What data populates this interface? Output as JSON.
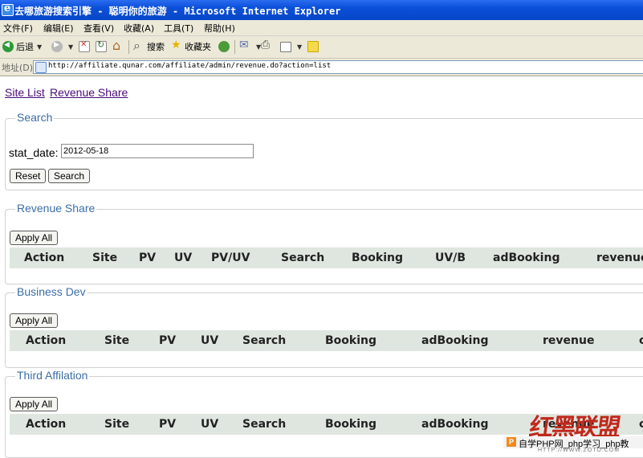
{
  "window": {
    "title": "去哪旅游搜索引擎 - 聪明你的旅游 - Microsoft Internet Explorer"
  },
  "menu": [
    "文件(F)",
    "编辑(E)",
    "查看(V)",
    "收藏(A)",
    "工具(T)",
    "帮助(H)"
  ],
  "toolbar": {
    "back": "后退",
    "search": "搜索",
    "favorites": "收藏夹"
  },
  "address": {
    "label": "地址(D)",
    "url": "http://affiliate.qunar.com/affiliate/admin/revenue.do?action=list"
  },
  "nav": {
    "site_list": "Site List",
    "revenue_share": "Revenue Share"
  },
  "search": {
    "legend": "Search",
    "field_label": "stat_date:",
    "field_value": "2012-05-18",
    "reset": "Reset",
    "search": "Search"
  },
  "sections": [
    {
      "legend": "Revenue Share",
      "apply": "Apply All",
      "columns": [
        "Action",
        "Site",
        "PV",
        "UV",
        "PV/UV",
        "Search",
        "Booking",
        "UV/B",
        "adBooking",
        "revenue"
      ]
    },
    {
      "legend": "Business Dev",
      "apply": "Apply All",
      "columns": [
        "Action",
        "Site",
        "PV",
        "UV",
        "Search",
        "Booking",
        "adBooking",
        "revenue",
        "c"
      ]
    },
    {
      "legend": "Third Affilation",
      "apply": "Apply All",
      "columns": [
        "Action",
        "Site",
        "PV",
        "UV",
        "Search",
        "Booking",
        "adBooking",
        "revenue",
        "c"
      ]
    }
  ],
  "watermark": {
    "logo": "红黑联盟",
    "p": "P",
    "text": "自学PHP网_php学习_php教",
    "url": "HTTP://WWW.ZOTO.COM"
  }
}
